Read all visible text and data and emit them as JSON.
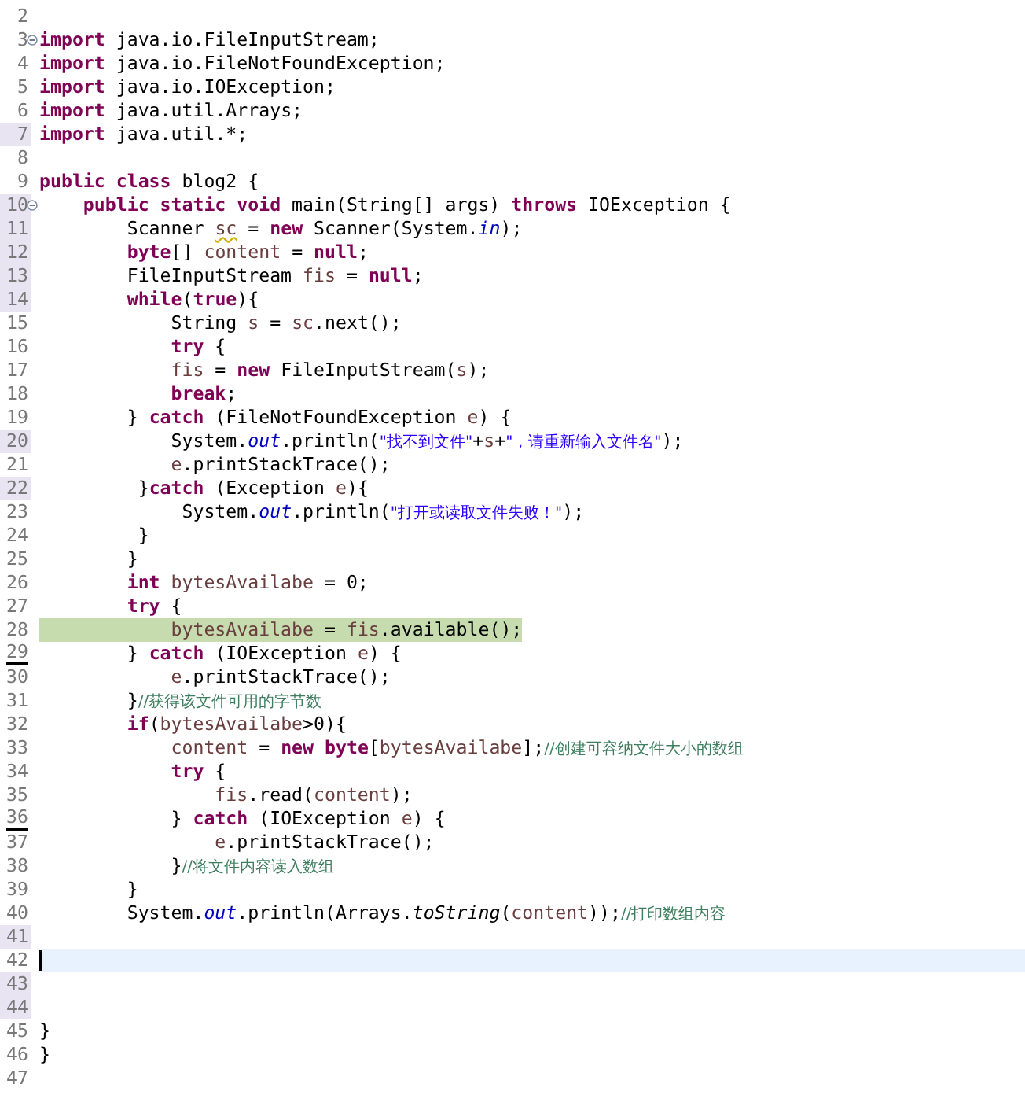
{
  "editor": {
    "lines": [
      {
        "number": "2",
        "foldable": false,
        "gutter_marked": false,
        "underlined": false,
        "highlighted": false,
        "current": false
      },
      {
        "number": "3",
        "foldable": true,
        "gutter_marked": false,
        "underlined": false,
        "highlighted": false,
        "current": false,
        "tokens": [
          {
            "kind": "keyword",
            "text": "import"
          },
          {
            "kind": "plain",
            "text": " java.io.FileInputStream;"
          }
        ]
      },
      {
        "number": "4",
        "foldable": false,
        "gutter_marked": false,
        "underlined": false,
        "highlighted": false,
        "current": false,
        "tokens": [
          {
            "kind": "keyword",
            "text": "import"
          },
          {
            "kind": "plain",
            "text": " java.io.FileNotFoundException;"
          }
        ]
      },
      {
        "number": "5",
        "foldable": false,
        "gutter_marked": false,
        "underlined": false,
        "highlighted": false,
        "current": false,
        "tokens": [
          {
            "kind": "keyword",
            "text": "import"
          },
          {
            "kind": "plain",
            "text": " java.io.IOException;"
          }
        ]
      },
      {
        "number": "6",
        "foldable": false,
        "gutter_marked": false,
        "underlined": false,
        "highlighted": false,
        "current": false,
        "tokens": [
          {
            "kind": "keyword",
            "text": "import"
          },
          {
            "kind": "plain",
            "text": " java.util.Arrays;"
          }
        ]
      },
      {
        "number": "7",
        "foldable": false,
        "gutter_marked": true,
        "underlined": false,
        "highlighted": false,
        "current": false,
        "tokens": [
          {
            "kind": "keyword",
            "text": "import"
          },
          {
            "kind": "plain",
            "text": " java.util.*;"
          }
        ]
      },
      {
        "number": "8",
        "foldable": false,
        "gutter_marked": false,
        "underlined": false,
        "highlighted": false,
        "current": false
      },
      {
        "number": "9",
        "foldable": false,
        "gutter_marked": false,
        "underlined": false,
        "highlighted": false,
        "current": false,
        "tokens": [
          {
            "kind": "keyword",
            "text": "public class"
          },
          {
            "kind": "plain",
            "text": " blog2 {"
          }
        ]
      },
      {
        "number": "10",
        "foldable": true,
        "gutter_marked": true,
        "underlined": false,
        "highlighted": false,
        "current": false,
        "tokens": [
          {
            "kind": "keyword",
            "text": "    public static void"
          },
          {
            "kind": "plain",
            "text": " main(String[] args) "
          },
          {
            "kind": "keyword",
            "text": "throws"
          },
          {
            "kind": "plain",
            "text": " IOException {"
          }
        ]
      },
      {
        "number": "11",
        "foldable": false,
        "gutter_marked": true,
        "underlined": false,
        "highlighted": false,
        "current": false,
        "tokens": [
          {
            "kind": "plain",
            "text": "        Scanner "
          },
          {
            "kind": "unused-local",
            "text": "sc"
          },
          {
            "kind": "plain",
            "text": " = "
          },
          {
            "kind": "keyword",
            "text": "new"
          },
          {
            "kind": "plain",
            "text": " Scanner(System."
          },
          {
            "kind": "field",
            "text": "in"
          },
          {
            "kind": "plain",
            "text": ");"
          }
        ]
      },
      {
        "number": "12",
        "foldable": false,
        "gutter_marked": true,
        "underlined": false,
        "highlighted": false,
        "current": false,
        "tokens": [
          {
            "kind": "keyword",
            "text": "        byte"
          },
          {
            "kind": "plain",
            "text": "[] "
          },
          {
            "kind": "local",
            "text": "content"
          },
          {
            "kind": "plain",
            "text": " = "
          },
          {
            "kind": "keyword",
            "text": "null"
          },
          {
            "kind": "plain",
            "text": ";"
          }
        ]
      },
      {
        "number": "13",
        "foldable": false,
        "gutter_marked": true,
        "underlined": false,
        "highlighted": false,
        "current": false,
        "tokens": [
          {
            "kind": "plain",
            "text": "        FileInputStream "
          },
          {
            "kind": "local",
            "text": "fis"
          },
          {
            "kind": "plain",
            "text": " = "
          },
          {
            "kind": "keyword",
            "text": "null"
          },
          {
            "kind": "plain",
            "text": ";"
          }
        ]
      },
      {
        "number": "14",
        "foldable": false,
        "gutter_marked": true,
        "underlined": false,
        "highlighted": false,
        "current": false,
        "tokens": [
          {
            "kind": "keyword",
            "text": "        while"
          },
          {
            "kind": "plain",
            "text": "("
          },
          {
            "kind": "keyword",
            "text": "true"
          },
          {
            "kind": "plain",
            "text": "){"
          }
        ]
      },
      {
        "number": "15",
        "foldable": false,
        "gutter_marked": false,
        "underlined": false,
        "highlighted": false,
        "current": false,
        "tokens": [
          {
            "kind": "plain",
            "text": "            String "
          },
          {
            "kind": "local",
            "text": "s"
          },
          {
            "kind": "plain",
            "text": " = "
          },
          {
            "kind": "local",
            "text": "sc"
          },
          {
            "kind": "plain",
            "text": ".next();"
          }
        ]
      },
      {
        "number": "16",
        "foldable": false,
        "gutter_marked": false,
        "underlined": false,
        "highlighted": false,
        "current": false,
        "tokens": [
          {
            "kind": "keyword",
            "text": "            try"
          },
          {
            "kind": "plain",
            "text": " {"
          }
        ]
      },
      {
        "number": "17",
        "foldable": false,
        "gutter_marked": false,
        "underlined": false,
        "highlighted": false,
        "current": false,
        "tokens": [
          {
            "kind": "local",
            "text": "            fis"
          },
          {
            "kind": "plain",
            "text": " = "
          },
          {
            "kind": "keyword",
            "text": "new"
          },
          {
            "kind": "plain",
            "text": " FileInputStream("
          },
          {
            "kind": "local",
            "text": "s"
          },
          {
            "kind": "plain",
            "text": ");"
          }
        ]
      },
      {
        "number": "18",
        "foldable": false,
        "gutter_marked": false,
        "underlined": false,
        "highlighted": false,
        "current": false,
        "tokens": [
          {
            "kind": "keyword",
            "text": "            break"
          },
          {
            "kind": "plain",
            "text": ";"
          }
        ]
      },
      {
        "number": "19",
        "foldable": false,
        "gutter_marked": false,
        "underlined": false,
        "highlighted": false,
        "current": false,
        "tokens": [
          {
            "kind": "plain",
            "text": "        } "
          },
          {
            "kind": "keyword",
            "text": "catch"
          },
          {
            "kind": "plain",
            "text": " (FileNotFoundException "
          },
          {
            "kind": "local",
            "text": "e"
          },
          {
            "kind": "plain",
            "text": ") {"
          }
        ]
      },
      {
        "number": "20",
        "foldable": false,
        "gutter_marked": true,
        "underlined": false,
        "highlighted": false,
        "current": false,
        "tokens": [
          {
            "kind": "plain",
            "text": "            System."
          },
          {
            "kind": "field",
            "text": "out"
          },
          {
            "kind": "plain",
            "text": ".println("
          },
          {
            "kind": "string",
            "text": "\"找不到文件\""
          },
          {
            "kind": "plain",
            "text": "+"
          },
          {
            "kind": "local",
            "text": "s"
          },
          {
            "kind": "plain",
            "text": "+"
          },
          {
            "kind": "string",
            "text": "\"，请重新输入文件名\""
          },
          {
            "kind": "plain",
            "text": ");"
          }
        ]
      },
      {
        "number": "21",
        "foldable": false,
        "gutter_marked": false,
        "underlined": false,
        "highlighted": false,
        "current": false,
        "tokens": [
          {
            "kind": "local",
            "text": "            e"
          },
          {
            "kind": "plain",
            "text": ".printStackTrace();"
          }
        ]
      },
      {
        "number": "22",
        "foldable": false,
        "gutter_marked": true,
        "underlined": false,
        "highlighted": false,
        "current": false,
        "tokens": [
          {
            "kind": "plain",
            "text": "         }"
          },
          {
            "kind": "keyword",
            "text": "catch"
          },
          {
            "kind": "plain",
            "text": " (Exception "
          },
          {
            "kind": "local",
            "text": "e"
          },
          {
            "kind": "plain",
            "text": "){"
          }
        ]
      },
      {
        "number": "23",
        "foldable": false,
        "gutter_marked": false,
        "underlined": false,
        "highlighted": false,
        "current": false,
        "tokens": [
          {
            "kind": "plain",
            "text": "             System."
          },
          {
            "kind": "field",
            "text": "out"
          },
          {
            "kind": "plain",
            "text": ".println("
          },
          {
            "kind": "string",
            "text": "\"打开或读取文件失败！\""
          },
          {
            "kind": "plain",
            "text": ");"
          }
        ]
      },
      {
        "number": "24",
        "foldable": false,
        "gutter_marked": false,
        "underlined": false,
        "highlighted": false,
        "current": false,
        "tokens": [
          {
            "kind": "plain",
            "text": "         }"
          }
        ]
      },
      {
        "number": "25",
        "foldable": false,
        "gutter_marked": false,
        "underlined": false,
        "highlighted": false,
        "current": false,
        "tokens": [
          {
            "kind": "plain",
            "text": "        }"
          }
        ]
      },
      {
        "number": "26",
        "foldable": false,
        "gutter_marked": false,
        "underlined": false,
        "highlighted": false,
        "current": false,
        "tokens": [
          {
            "kind": "keyword",
            "text": "        int"
          },
          {
            "kind": "local",
            "text": " bytesAvailabe"
          },
          {
            "kind": "plain",
            "text": " = 0;"
          }
        ]
      },
      {
        "number": "27",
        "foldable": false,
        "gutter_marked": false,
        "underlined": false,
        "highlighted": false,
        "current": false,
        "tokens": [
          {
            "kind": "keyword",
            "text": "        try"
          },
          {
            "kind": "plain",
            "text": " {"
          }
        ]
      },
      {
        "number": "28",
        "foldable": false,
        "gutter_marked": false,
        "underlined": false,
        "highlighted": true,
        "current": false,
        "tokens": [
          {
            "kind": "local",
            "text": "            bytesAvailabe"
          },
          {
            "kind": "plain",
            "text": " = "
          },
          {
            "kind": "local",
            "text": "fis"
          },
          {
            "kind": "plain",
            "text": ".available();"
          }
        ]
      },
      {
        "number": "29",
        "foldable": false,
        "gutter_marked": false,
        "underlined": true,
        "highlighted": false,
        "current": false,
        "tokens": [
          {
            "kind": "plain",
            "text": "        } "
          },
          {
            "kind": "keyword",
            "text": "catch"
          },
          {
            "kind": "plain",
            "text": " (IOException "
          },
          {
            "kind": "local",
            "text": "e"
          },
          {
            "kind": "plain",
            "text": ") {"
          }
        ]
      },
      {
        "number": "30",
        "foldable": false,
        "gutter_marked": false,
        "underlined": false,
        "highlighted": false,
        "current": false,
        "tokens": [
          {
            "kind": "local",
            "text": "            e"
          },
          {
            "kind": "plain",
            "text": ".printStackTrace();"
          }
        ]
      },
      {
        "number": "31",
        "foldable": false,
        "gutter_marked": false,
        "underlined": false,
        "highlighted": false,
        "current": false,
        "tokens": [
          {
            "kind": "plain",
            "text": "        }"
          },
          {
            "kind": "comment",
            "text": "//获得该文件可用的字节数"
          }
        ]
      },
      {
        "number": "32",
        "foldable": false,
        "gutter_marked": false,
        "underlined": false,
        "highlighted": false,
        "current": false,
        "tokens": [
          {
            "kind": "keyword",
            "text": "        if"
          },
          {
            "kind": "plain",
            "text": "("
          },
          {
            "kind": "local",
            "text": "bytesAvailabe"
          },
          {
            "kind": "plain",
            "text": ">0){"
          }
        ]
      },
      {
        "number": "33",
        "foldable": false,
        "gutter_marked": false,
        "underlined": false,
        "highlighted": false,
        "current": false,
        "tokens": [
          {
            "kind": "local",
            "text": "            content"
          },
          {
            "kind": "plain",
            "text": " = "
          },
          {
            "kind": "keyword",
            "text": "new byte"
          },
          {
            "kind": "plain",
            "text": "["
          },
          {
            "kind": "local",
            "text": "bytesAvailabe"
          },
          {
            "kind": "plain",
            "text": "];"
          },
          {
            "kind": "comment",
            "text": "//创建可容纳文件大小的数组"
          }
        ]
      },
      {
        "number": "34",
        "foldable": false,
        "gutter_marked": false,
        "underlined": false,
        "highlighted": false,
        "current": false,
        "tokens": [
          {
            "kind": "keyword",
            "text": "            try"
          },
          {
            "kind": "plain",
            "text": " {"
          }
        ]
      },
      {
        "number": "35",
        "foldable": false,
        "gutter_marked": false,
        "underlined": false,
        "highlighted": false,
        "current": false,
        "tokens": [
          {
            "kind": "local",
            "text": "                fis"
          },
          {
            "kind": "plain",
            "text": ".read("
          },
          {
            "kind": "local",
            "text": "content"
          },
          {
            "kind": "plain",
            "text": ");"
          }
        ]
      },
      {
        "number": "36",
        "foldable": false,
        "gutter_marked": false,
        "underlined": true,
        "highlighted": false,
        "current": false,
        "tokens": [
          {
            "kind": "plain",
            "text": "            } "
          },
          {
            "kind": "keyword",
            "text": "catch"
          },
          {
            "kind": "plain",
            "text": " (IOException "
          },
          {
            "kind": "local",
            "text": "e"
          },
          {
            "kind": "plain",
            "text": ") {"
          }
        ]
      },
      {
        "number": "37",
        "foldable": false,
        "gutter_marked": false,
        "underlined": false,
        "highlighted": false,
        "current": false,
        "tokens": [
          {
            "kind": "local",
            "text": "                e"
          },
          {
            "kind": "plain",
            "text": ".printStackTrace();"
          }
        ]
      },
      {
        "number": "38",
        "foldable": false,
        "gutter_marked": false,
        "underlined": false,
        "highlighted": false,
        "current": false,
        "tokens": [
          {
            "kind": "plain",
            "text": "            }"
          },
          {
            "kind": "comment",
            "text": "//将文件内容读入数组"
          }
        ]
      },
      {
        "number": "39",
        "foldable": false,
        "gutter_marked": false,
        "underlined": false,
        "highlighted": false,
        "current": false,
        "tokens": [
          {
            "kind": "plain",
            "text": "        }"
          }
        ]
      },
      {
        "number": "40",
        "foldable": false,
        "gutter_marked": false,
        "underlined": false,
        "highlighted": false,
        "current": false,
        "tokens": [
          {
            "kind": "plain",
            "text": "        System."
          },
          {
            "kind": "field",
            "text": "out"
          },
          {
            "kind": "plain",
            "text": ".println(Arrays."
          },
          {
            "kind": "static-method",
            "text": "toString"
          },
          {
            "kind": "plain",
            "text": "("
          },
          {
            "kind": "local",
            "text": "content"
          },
          {
            "kind": "plain",
            "text": "));"
          },
          {
            "kind": "comment",
            "text": "//打印数组内容"
          }
        ]
      },
      {
        "number": "41",
        "foldable": false,
        "gutter_marked": true,
        "underlined": false,
        "highlighted": false,
        "current": false
      },
      {
        "number": "42",
        "foldable": false,
        "gutter_marked": false,
        "underlined": false,
        "highlighted": false,
        "current": true
      },
      {
        "number": "43",
        "foldable": false,
        "gutter_marked": true,
        "underlined": false,
        "highlighted": false,
        "current": false
      },
      {
        "number": "44",
        "foldable": false,
        "gutter_marked": true,
        "underlined": false,
        "highlighted": false,
        "current": false
      },
      {
        "number": "45",
        "foldable": false,
        "gutter_marked": false,
        "underlined": false,
        "highlighted": false,
        "current": false,
        "tokens": [
          {
            "kind": "plain",
            "text": "}"
          }
        ]
      },
      {
        "number": "46",
        "foldable": false,
        "gutter_marked": false,
        "underlined": false,
        "highlighted": false,
        "current": false,
        "tokens": [
          {
            "kind": "plain",
            "text": "}"
          }
        ]
      },
      {
        "number": "47",
        "foldable": false,
        "gutter_marked": false,
        "underlined": false,
        "highlighted": false,
        "current": false
      }
    ]
  }
}
